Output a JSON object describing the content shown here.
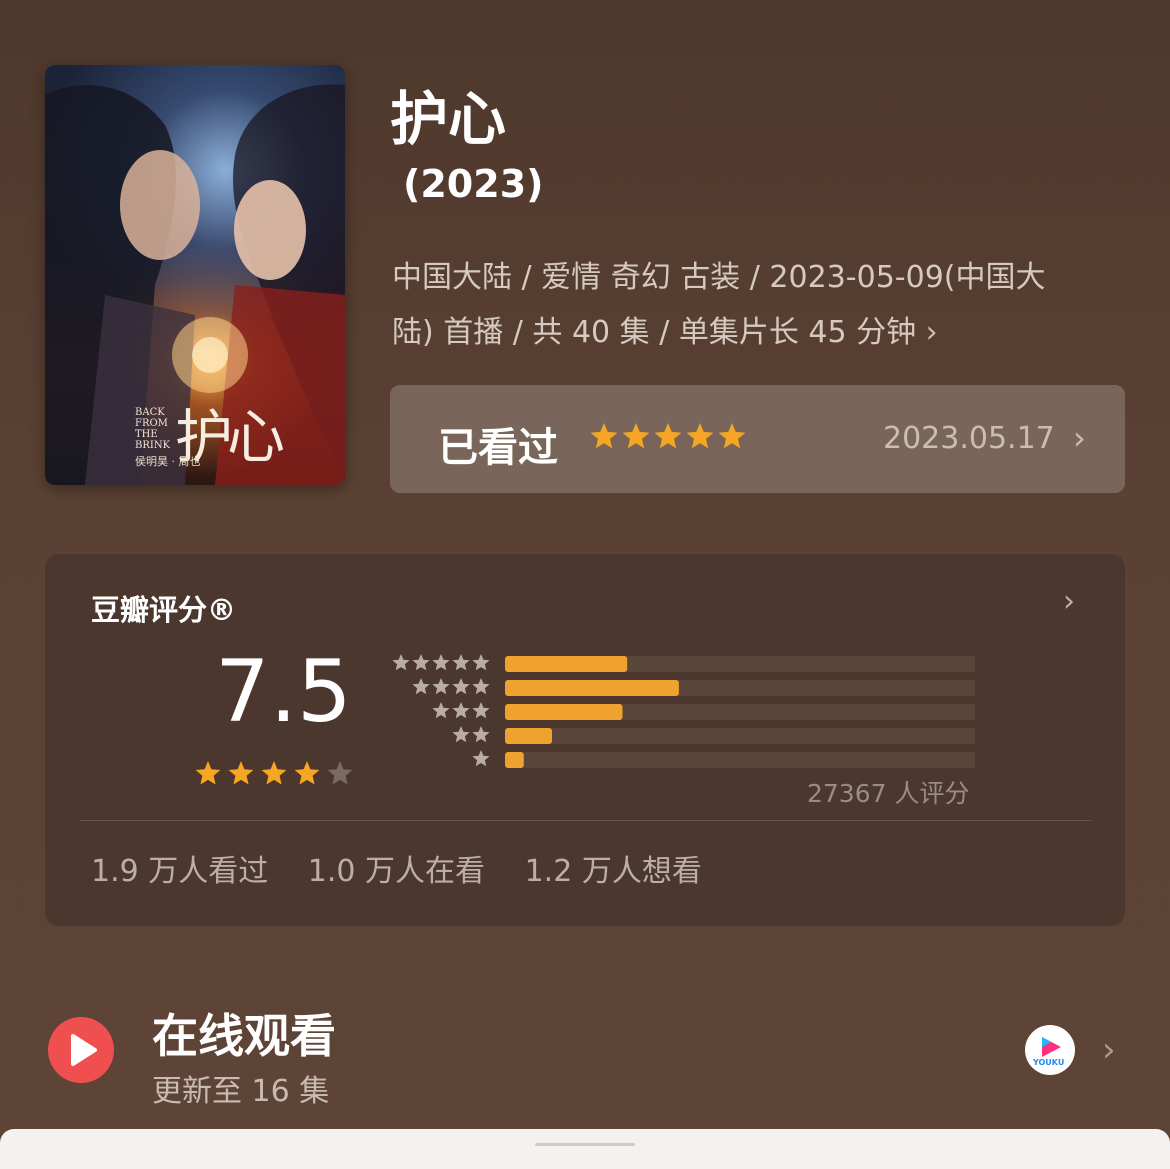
{
  "poster": {
    "title_art": "护心",
    "english": "BACK FROM THE BRINK",
    "credits": "侯明昊 · 周也"
  },
  "title": "护心",
  "year": "(2023)",
  "meta_line1": "中国大陆 / 爱情 奇幻 古装 / 2023-05-09(中国大",
  "meta_line2": "陆) 首播 / 共 40 集 / 单集片长 45 分钟",
  "meta_chevron": "›",
  "watched": {
    "label": "已看过",
    "my_rating": 5,
    "date": "2023.05.17",
    "chevron": "›"
  },
  "douban": {
    "heading": "豆瓣评分®",
    "chevron": "›",
    "score": "7.5",
    "score_stars": 4,
    "distribution": [
      {
        "stars": 5,
        "fraction": 0.26
      },
      {
        "stars": 4,
        "fraction": 0.37
      },
      {
        "stars": 3,
        "fraction": 0.25
      },
      {
        "stars": 2,
        "fraction": 0.1
      },
      {
        "stars": 1,
        "fraction": 0.04
      }
    ],
    "rating_count": "27367 人评分",
    "stats": [
      "1.9 万人看过",
      "1.0 万人在看",
      "1.2 万人想看"
    ]
  },
  "online": {
    "title": "在线观看",
    "subtitle": "更新至 16 集",
    "platform_label": "YOUKU",
    "chevron": "›"
  },
  "colors": {
    "star": "#f5a623",
    "bar_fill": "#f0a22e",
    "bar_track": "#5a4539",
    "play": "#f04f50"
  }
}
